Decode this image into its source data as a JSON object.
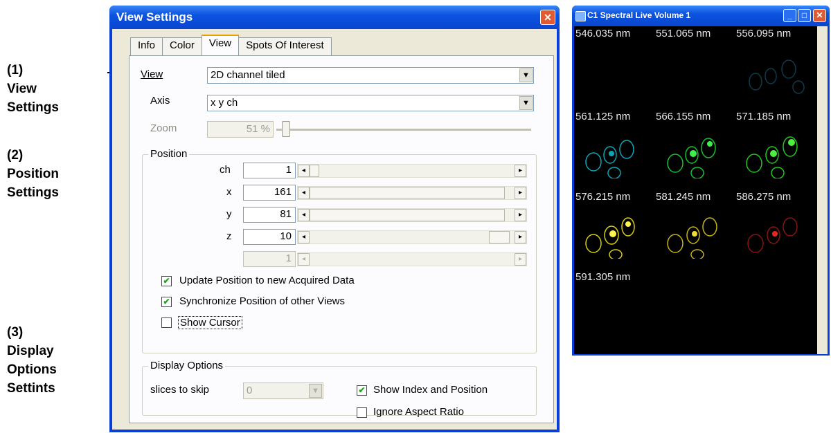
{
  "annotations": [
    {
      "number": "(1)",
      "lines": [
        "View",
        "Settings"
      ]
    },
    {
      "number": "(2)",
      "lines": [
        "Position",
        "Settings"
      ]
    },
    {
      "number": "(3)",
      "lines": [
        "Display",
        "Options",
        "Settints"
      ]
    }
  ],
  "dialog": {
    "title": "View Settings",
    "close_icon": "close-icon",
    "tabs": [
      {
        "label": "Info",
        "active": false
      },
      {
        "label": "Color",
        "active": false
      },
      {
        "label": "View",
        "active": true
      },
      {
        "label": "Spots Of Interest",
        "active": false
      }
    ],
    "view": {
      "label": "View",
      "value": "2D channel tiled"
    },
    "axis": {
      "label": "Axis",
      "value": "x y ch"
    },
    "zoom": {
      "label": "Zoom",
      "value": "51 %"
    },
    "position": {
      "group_title": "Position",
      "rows": [
        {
          "label": "ch",
          "value": "1",
          "enabled": true
        },
        {
          "label": "x",
          "value": "161",
          "enabled": true
        },
        {
          "label": "y",
          "value": "81",
          "enabled": true
        },
        {
          "label": "z",
          "value": "10",
          "enabled": true
        },
        {
          "label": "",
          "value": "1",
          "enabled": false
        }
      ],
      "checkboxes": [
        {
          "label": "Update Position to new Acquired Data",
          "checked": true
        },
        {
          "label": "Synchronize Position of other Views",
          "checked": true
        },
        {
          "label": "Show Cursor",
          "checked": false
        }
      ]
    },
    "display_options": {
      "group_title": "Display Options",
      "slices_label": "slices to skip",
      "slices_value": "0",
      "show_index": {
        "label": "Show Index and Position",
        "checked": true
      },
      "ignore_aspect": {
        "label": "Ignore Aspect Ratio",
        "checked": false
      }
    }
  },
  "image_window": {
    "title": "C1 Spectral Live Volume 1",
    "wavelengths": [
      {
        "label": "546.035 nm",
        "color": "#000000"
      },
      {
        "label": "551.065 nm",
        "color": "#0b0b3a"
      },
      {
        "label": "556.095 nm",
        "color": "#0e3a4a"
      },
      {
        "label": "561.125 nm",
        "color": "#0fa7b8"
      },
      {
        "label": "566.155 nm",
        "color": "#17c230"
      },
      {
        "label": "571.185 nm",
        "color": "#23c81f"
      },
      {
        "label": "576.215 nm",
        "color": "#d9d012"
      },
      {
        "label": "581.245 nm",
        "color": "#c8b418"
      },
      {
        "label": "586.275 nm",
        "color": "#d81a12"
      },
      {
        "label": "591.305 nm",
        "color": "#000000"
      }
    ]
  }
}
